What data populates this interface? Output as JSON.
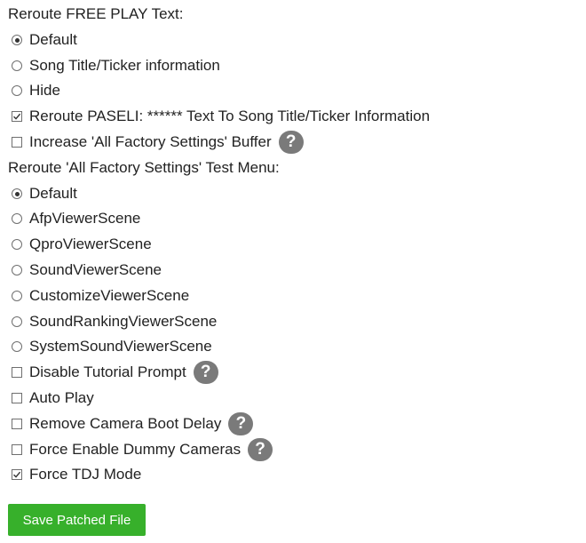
{
  "sections": {
    "free_play_heading": "Reroute FREE PLAY Text:",
    "free_play_options": [
      "Default",
      "Song Title/Ticker information",
      "Hide"
    ],
    "free_play_selected": "Default",
    "paseli_label": "Reroute PASELI: ****** Text To Song Title/Ticker Information",
    "paseli_checked": true,
    "factory_buffer_label": "Increase 'All Factory Settings' Buffer",
    "factory_buffer_checked": false,
    "test_menu_heading": "Reroute 'All Factory Settings' Test Menu:",
    "test_menu_options": [
      "Default",
      "AfpViewerScene",
      "QproViewerScene",
      "SoundViewerScene",
      "CustomizeViewerScene",
      "SoundRankingViewerScene",
      "SystemSoundViewerScene"
    ],
    "test_menu_selected": "Default",
    "tutorial_label": "Disable Tutorial Prompt",
    "tutorial_checked": false,
    "autoplay_label": "Auto Play",
    "autoplay_checked": false,
    "camera_delay_label": "Remove Camera Boot Delay",
    "camera_delay_checked": false,
    "dummy_cameras_label": "Force Enable Dummy Cameras",
    "dummy_cameras_checked": false,
    "tdj_label": "Force TDJ Mode",
    "tdj_checked": true
  },
  "help_icon_text": "?",
  "save_button_label": "Save Patched File",
  "colors": {
    "save_button": "#37b02b",
    "help_icon": "#7a7a7a"
  }
}
